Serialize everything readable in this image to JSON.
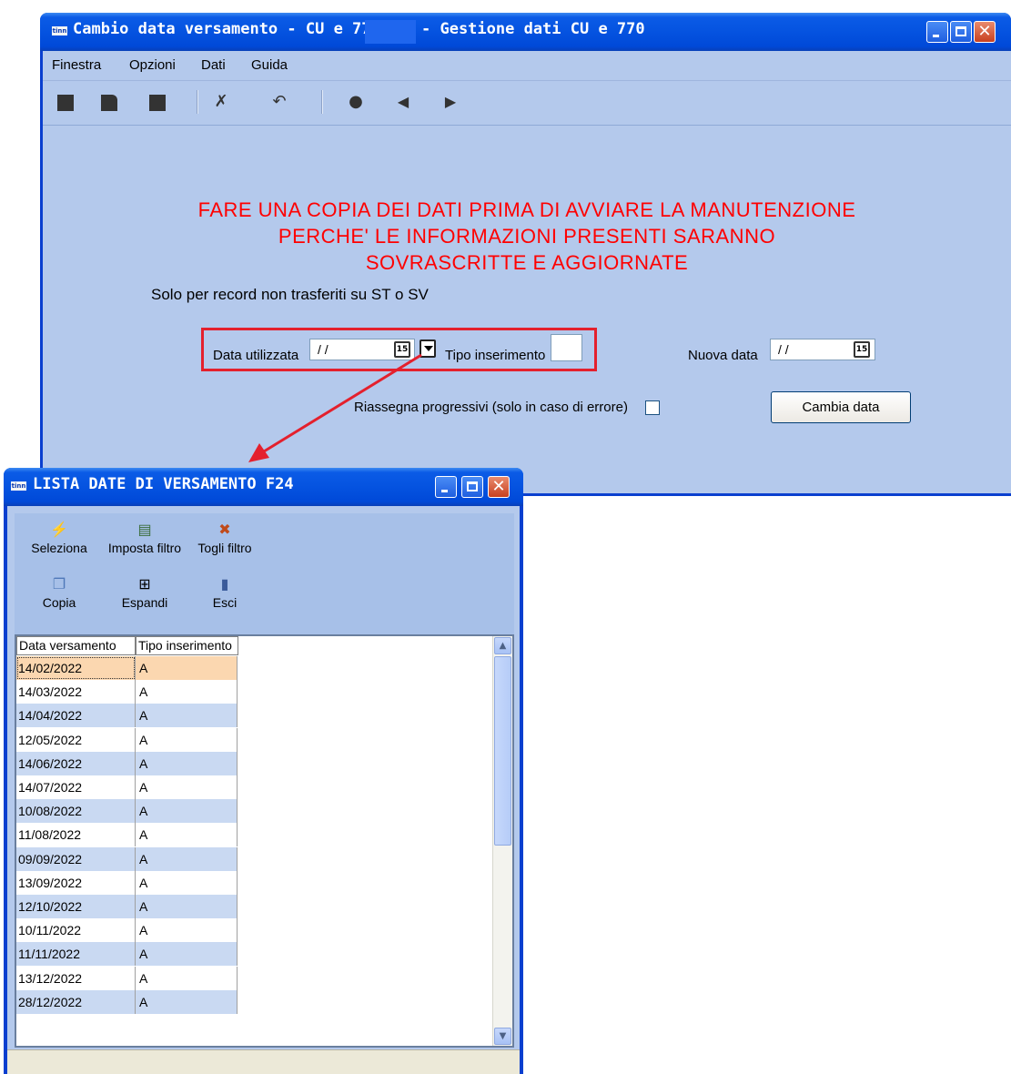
{
  "main_window": {
    "title_left": "Cambio data versamento - CU e 770",
    "title_right": "- Gestione dati CU e 770",
    "app_icon_text": "tinn",
    "menu": [
      "Finestra",
      "Opzioni",
      "Dati",
      "Guida"
    ],
    "warning_lines": [
      "FARE UNA COPIA DEI DATI PRIMA DI AVVIARE LA MANUTENZIONE",
      "PERCHE' LE INFORMAZIONI PRESENTI SARANNO",
      "SOVRASCRITTE E AGGIORNATE"
    ],
    "note": "Solo per record non trasferiti su ST o SV",
    "data_utilizzata_label": "Data utilizzata",
    "data_utilizzata_value": " / /",
    "tipo_inserimento_label": "Tipo inserimento",
    "tipo_inserimento_value": "",
    "nuova_data_label": "Nuova data",
    "nuova_data_value": " / /",
    "riassegna_label": "Riassegna progressivi (solo in caso di errore)",
    "cambia_data_button": "Cambia data",
    "calendar_icon_text": "15"
  },
  "list_window": {
    "title": "LISTA DATE DI VERSAMENTO F24",
    "toolbar": [
      "Seleziona",
      "Imposta filtro",
      "Togli filtro",
      "Copia",
      "Espandi",
      "Esci"
    ],
    "columns": [
      "Data versamento",
      "Tipo inserimento"
    ],
    "rows": [
      [
        "14/02/2022",
        "A"
      ],
      [
        "14/03/2022",
        "A"
      ],
      [
        "14/04/2022",
        "A"
      ],
      [
        "12/05/2022",
        "A"
      ],
      [
        "14/06/2022",
        "A"
      ],
      [
        "14/07/2022",
        "A"
      ],
      [
        "10/08/2022",
        "A"
      ],
      [
        "11/08/2022",
        "A"
      ],
      [
        "09/09/2022",
        "A"
      ],
      [
        "13/09/2022",
        "A"
      ],
      [
        "12/10/2022",
        "A"
      ],
      [
        "10/11/2022",
        "A"
      ],
      [
        "11/11/2022",
        "A"
      ],
      [
        "13/12/2022",
        "A"
      ],
      [
        "28/12/2022",
        "A"
      ]
    ]
  },
  "colors": {
    "warning": "#ff0000",
    "annotation": "#e4202d",
    "selected_row": "#fbd7b0",
    "alt_row": "#c9d9f2"
  }
}
